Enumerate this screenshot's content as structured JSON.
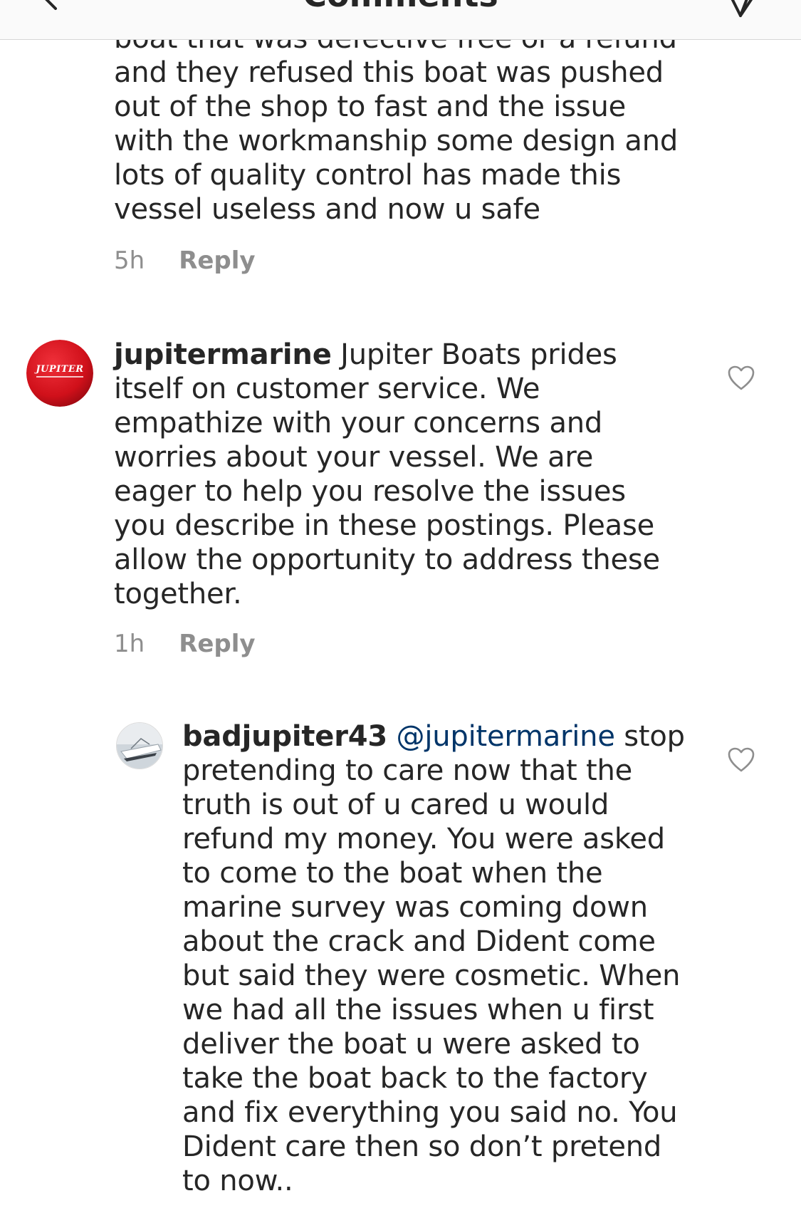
{
  "header": {
    "title": "Comments",
    "back_icon": "chevron-left-icon",
    "send_icon": "paper-plane-icon"
  },
  "comments": [
    {
      "text": "boat that was defective free or a refund and they refused this boat was pushed out of the shop to fast and the issue with the workmanship some design and lots of quality control has made this vessel useless and now u safe",
      "time": "5h",
      "reply_label": "Reply"
    },
    {
      "username": "jupitermarine",
      "avatar_text": "JUPITER",
      "text": "Jupiter Boats prides itself on customer service.  We empathize with your concerns and worries about your vessel.  We are eager to help you resolve the issues you describe in these postings.  Please allow the opportunity to address these together.",
      "time": "1h",
      "reply_label": "Reply",
      "like_icon": "heart-outline-icon"
    },
    {
      "username": "badjupiter43",
      "mention": "@jupitermarine",
      "text": "stop pretending to care now that the truth is out of u cared  u would refund my money. You were asked to come to the boat when the marine survey was coming down about the crack and Dident come but said they were cosmetic. When we had all the issues when u first deliver the boat u were asked to take the boat back to the factory and fix everything you said no. You Dident care then so don’t pretend to now..",
      "like_icon": "heart-outline-icon"
    }
  ],
  "colors": {
    "text": "#262626",
    "secondary": "#8e8e8e",
    "mention": "#003569",
    "avatar_red": "#d0101a",
    "header_bg": "#fafafa"
  }
}
